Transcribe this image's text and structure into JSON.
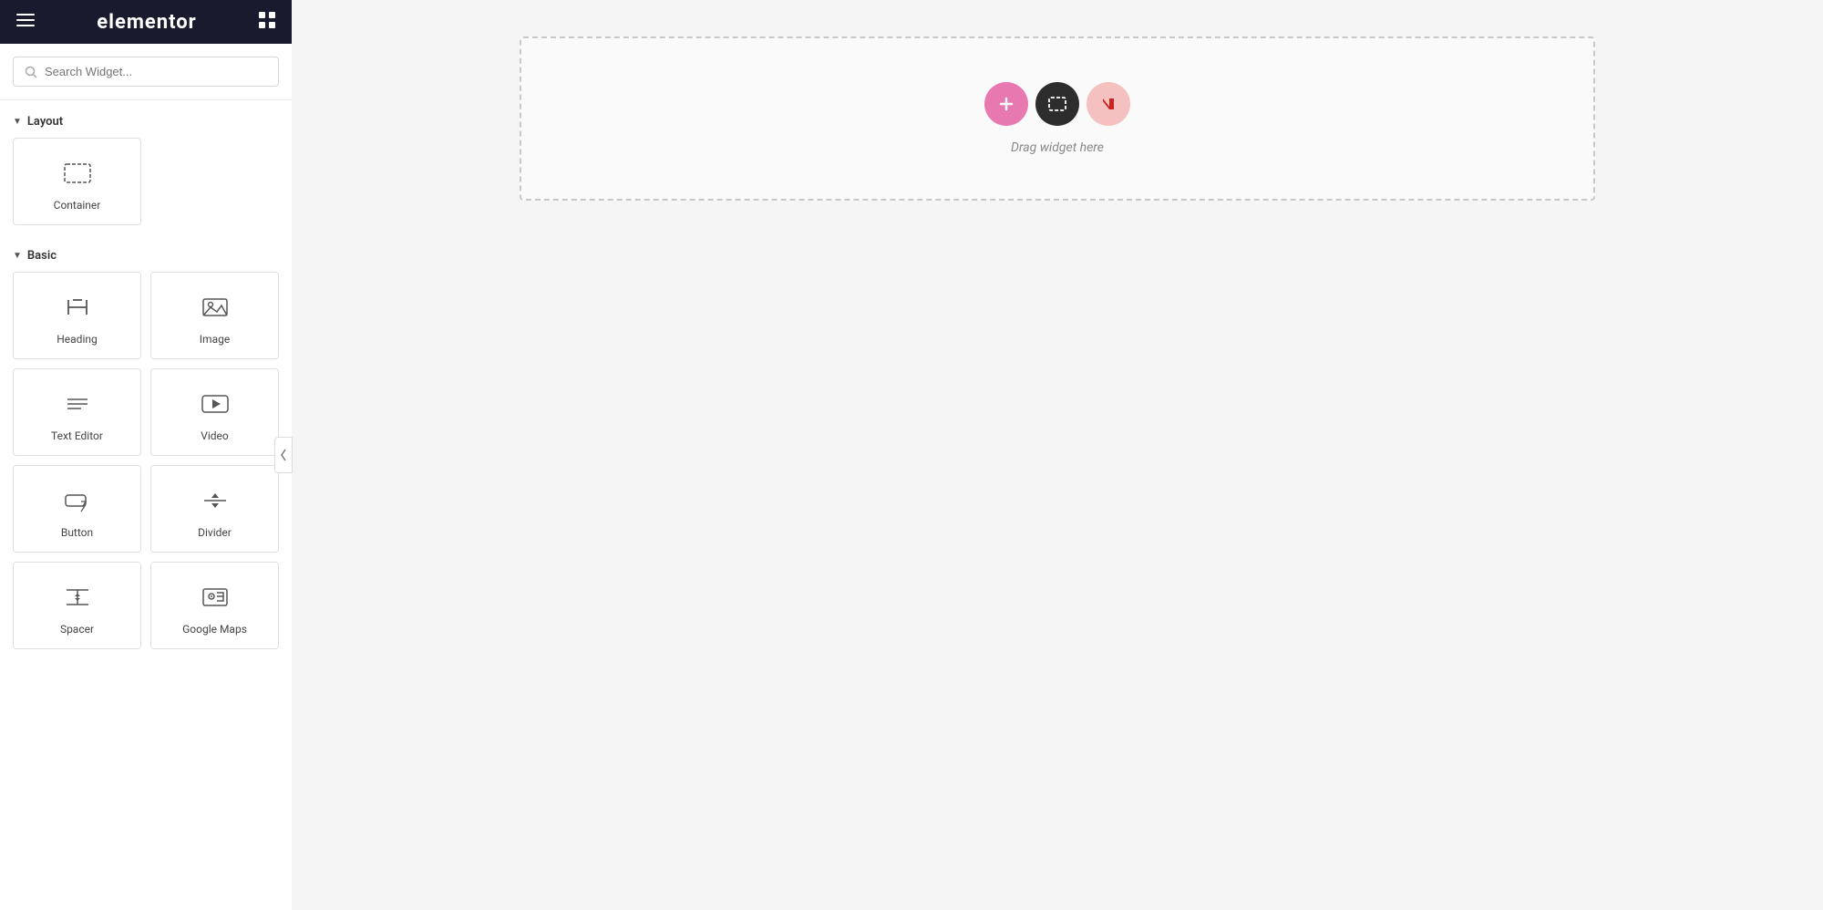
{
  "header": {
    "logo": "elementor",
    "hamburger_icon": "☰",
    "grid_icon": "⊞"
  },
  "search": {
    "placeholder": "Search Widget..."
  },
  "sections": [
    {
      "id": "layout",
      "label": "Layout",
      "expanded": true,
      "widgets": [
        {
          "id": "container",
          "label": "Container",
          "icon_type": "container"
        }
      ]
    },
    {
      "id": "basic",
      "label": "Basic",
      "expanded": true,
      "widgets": [
        {
          "id": "heading",
          "label": "Heading",
          "icon_type": "heading"
        },
        {
          "id": "image",
          "label": "Image",
          "icon_type": "image"
        },
        {
          "id": "text-editor",
          "label": "Text Editor",
          "icon_type": "text-editor"
        },
        {
          "id": "video",
          "label": "Video",
          "icon_type": "video"
        },
        {
          "id": "button",
          "label": "Button",
          "icon_type": "button"
        },
        {
          "id": "divider",
          "label": "Divider",
          "icon_type": "divider"
        },
        {
          "id": "spacer",
          "label": "Spacer",
          "icon_type": "spacer"
        },
        {
          "id": "google-maps",
          "label": "Google Maps",
          "icon_type": "google-maps"
        }
      ]
    }
  ],
  "canvas": {
    "drop_zone_label": "Drag widget here",
    "add_icon_color": "#e879b0",
    "container_icon_color": "#2d2d2d",
    "news_icon_bg": "#f5c0c0"
  }
}
